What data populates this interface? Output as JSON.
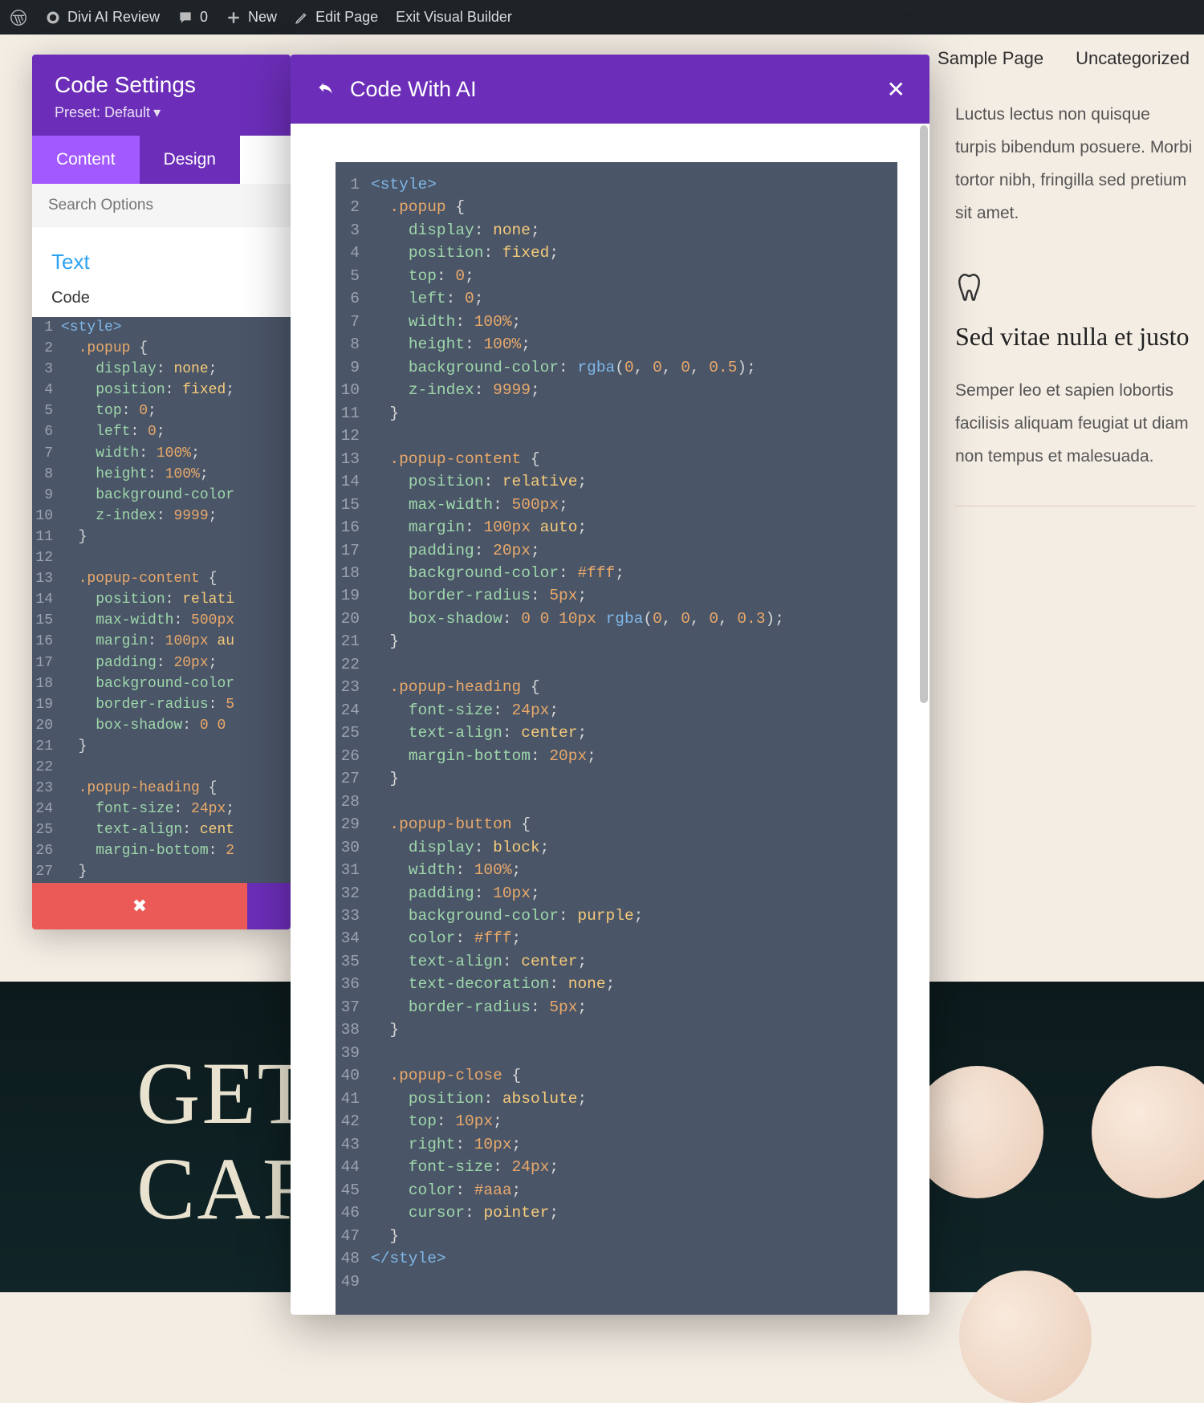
{
  "adminbar": {
    "site_title": "Divi AI Review",
    "comments_count": "0",
    "new_label": "New",
    "edit_page": "Edit Page",
    "exit_vb": "Exit Visual Builder"
  },
  "topnav": {
    "sample": "Sample Page",
    "uncat": "Uncategorized"
  },
  "side": {
    "blurb1_text": "Luctus lectus non quisque turpis bibendum posuere. Morbi tortor nibh, fringilla sed pretium sit amet.",
    "blurb2_title": "Sed vitae nulla et justo",
    "blurb2_text": "Semper leo et sapien lobortis facilisis aliquam feugiat ut diam non tempus et malesuada."
  },
  "hero": {
    "text": "GET\nCAR"
  },
  "sidebar": {
    "title": "Code Settings",
    "preset": "Preset: Default",
    "tabs": {
      "content": "Content",
      "design": "Design"
    },
    "search_placeholder": "Search Options",
    "section_text": "Text",
    "label_code": "Code",
    "code_lines": [
      [
        [
          "tag",
          "<style>"
        ]
      ],
      [
        [
          "p",
          "  "
        ],
        [
          "sel",
          ".popup"
        ],
        [
          "p",
          " {"
        ]
      ],
      [
        [
          "p",
          "    "
        ],
        [
          "prop",
          "display"
        ],
        [
          "p",
          ": "
        ],
        [
          "val",
          "none"
        ],
        [
          "p",
          ";"
        ]
      ],
      [
        [
          "p",
          "    "
        ],
        [
          "prop",
          "position"
        ],
        [
          "p",
          ": "
        ],
        [
          "val",
          "fixed"
        ],
        [
          "p",
          ";"
        ]
      ],
      [
        [
          "p",
          "    "
        ],
        [
          "prop",
          "top"
        ],
        [
          "p",
          ": "
        ],
        [
          "num",
          "0"
        ],
        [
          "p",
          ";"
        ]
      ],
      [
        [
          "p",
          "    "
        ],
        [
          "prop",
          "left"
        ],
        [
          "p",
          ": "
        ],
        [
          "num",
          "0"
        ],
        [
          "p",
          ";"
        ]
      ],
      [
        [
          "p",
          "    "
        ],
        [
          "prop",
          "width"
        ],
        [
          "p",
          ": "
        ],
        [
          "num",
          "100%"
        ],
        [
          "p",
          ";"
        ]
      ],
      [
        [
          "p",
          "    "
        ],
        [
          "prop",
          "height"
        ],
        [
          "p",
          ": "
        ],
        [
          "num",
          "100%"
        ],
        [
          "p",
          ";"
        ]
      ],
      [
        [
          "p",
          "    "
        ],
        [
          "prop",
          "background-color"
        ]
      ],
      [
        [
          "p",
          "    "
        ],
        [
          "prop",
          "z-index"
        ],
        [
          "p",
          ": "
        ],
        [
          "num",
          "9999"
        ],
        [
          "p",
          ";"
        ]
      ],
      [
        [
          "p",
          "  }"
        ]
      ],
      [
        [
          "p",
          ""
        ]
      ],
      [
        [
          "p",
          "  "
        ],
        [
          "sel",
          ".popup-content"
        ],
        [
          "p",
          " {"
        ]
      ],
      [
        [
          "p",
          "    "
        ],
        [
          "prop",
          "position"
        ],
        [
          "p",
          ": "
        ],
        [
          "val",
          "relati"
        ]
      ],
      [
        [
          "p",
          "    "
        ],
        [
          "prop",
          "max-width"
        ],
        [
          "p",
          ": "
        ],
        [
          "num",
          "500px"
        ]
      ],
      [
        [
          "p",
          "    "
        ],
        [
          "prop",
          "margin"
        ],
        [
          "p",
          ": "
        ],
        [
          "num",
          "100px"
        ],
        [
          "p",
          " "
        ],
        [
          "val",
          "au"
        ]
      ],
      [
        [
          "p",
          "    "
        ],
        [
          "prop",
          "padding"
        ],
        [
          "p",
          ": "
        ],
        [
          "num",
          "20px"
        ],
        [
          "p",
          ";"
        ]
      ],
      [
        [
          "p",
          "    "
        ],
        [
          "prop",
          "background-color"
        ]
      ],
      [
        [
          "p",
          "    "
        ],
        [
          "prop",
          "border-radius"
        ],
        [
          "p",
          ": "
        ],
        [
          "num",
          "5"
        ]
      ],
      [
        [
          "p",
          "    "
        ],
        [
          "prop",
          "box-shadow"
        ],
        [
          "p",
          ": "
        ],
        [
          "num",
          "0 0"
        ]
      ],
      [
        [
          "p",
          "  }"
        ]
      ],
      [
        [
          "p",
          ""
        ]
      ],
      [
        [
          "p",
          "  "
        ],
        [
          "sel",
          ".popup-heading"
        ],
        [
          "p",
          " {"
        ]
      ],
      [
        [
          "p",
          "    "
        ],
        [
          "prop",
          "font-size"
        ],
        [
          "p",
          ": "
        ],
        [
          "num",
          "24px"
        ],
        [
          "p",
          ";"
        ]
      ],
      [
        [
          "p",
          "    "
        ],
        [
          "prop",
          "text-align"
        ],
        [
          "p",
          ": "
        ],
        [
          "val",
          "cent"
        ]
      ],
      [
        [
          "p",
          "    "
        ],
        [
          "prop",
          "margin-bottom"
        ],
        [
          "p",
          ": "
        ],
        [
          "num",
          "2"
        ]
      ],
      [
        [
          "p",
          "  }"
        ]
      ]
    ]
  },
  "ai_panel": {
    "title": "Code With AI",
    "code_lines": [
      [
        [
          "tag",
          "<style>"
        ]
      ],
      [
        [
          "p",
          "  "
        ],
        [
          "sel",
          ".popup"
        ],
        [
          "p",
          " {"
        ]
      ],
      [
        [
          "p",
          "    "
        ],
        [
          "prop",
          "display"
        ],
        [
          "p",
          ": "
        ],
        [
          "val",
          "none"
        ],
        [
          "p",
          ";"
        ]
      ],
      [
        [
          "p",
          "    "
        ],
        [
          "prop",
          "position"
        ],
        [
          "p",
          ": "
        ],
        [
          "val",
          "fixed"
        ],
        [
          "p",
          ";"
        ]
      ],
      [
        [
          "p",
          "    "
        ],
        [
          "prop",
          "top"
        ],
        [
          "p",
          ": "
        ],
        [
          "num",
          "0"
        ],
        [
          "p",
          ";"
        ]
      ],
      [
        [
          "p",
          "    "
        ],
        [
          "prop",
          "left"
        ],
        [
          "p",
          ": "
        ],
        [
          "num",
          "0"
        ],
        [
          "p",
          ";"
        ]
      ],
      [
        [
          "p",
          "    "
        ],
        [
          "prop",
          "width"
        ],
        [
          "p",
          ": "
        ],
        [
          "num",
          "100%"
        ],
        [
          "p",
          ";"
        ]
      ],
      [
        [
          "p",
          "    "
        ],
        [
          "prop",
          "height"
        ],
        [
          "p",
          ": "
        ],
        [
          "num",
          "100%"
        ],
        [
          "p",
          ";"
        ]
      ],
      [
        [
          "p",
          "    "
        ],
        [
          "prop",
          "background-color"
        ],
        [
          "p",
          ": "
        ],
        [
          "fn",
          "rgba"
        ],
        [
          "p",
          "("
        ],
        [
          "num",
          "0"
        ],
        [
          "p",
          ", "
        ],
        [
          "num",
          "0"
        ],
        [
          "p",
          ", "
        ],
        [
          "num",
          "0"
        ],
        [
          "p",
          ", "
        ],
        [
          "num",
          "0.5"
        ],
        [
          "p",
          ");"
        ]
      ],
      [
        [
          "p",
          "    "
        ],
        [
          "prop",
          "z-index"
        ],
        [
          "p",
          ": "
        ],
        [
          "num",
          "9999"
        ],
        [
          "p",
          ";"
        ]
      ],
      [
        [
          "p",
          "  }"
        ]
      ],
      [
        [
          "p",
          ""
        ]
      ],
      [
        [
          "p",
          "  "
        ],
        [
          "sel",
          ".popup-content"
        ],
        [
          "p",
          " {"
        ]
      ],
      [
        [
          "p",
          "    "
        ],
        [
          "prop",
          "position"
        ],
        [
          "p",
          ": "
        ],
        [
          "val",
          "relative"
        ],
        [
          "p",
          ";"
        ]
      ],
      [
        [
          "p",
          "    "
        ],
        [
          "prop",
          "max-width"
        ],
        [
          "p",
          ": "
        ],
        [
          "num",
          "500px"
        ],
        [
          "p",
          ";"
        ]
      ],
      [
        [
          "p",
          "    "
        ],
        [
          "prop",
          "margin"
        ],
        [
          "p",
          ": "
        ],
        [
          "num",
          "100px"
        ],
        [
          "p",
          " "
        ],
        [
          "val",
          "auto"
        ],
        [
          "p",
          ";"
        ]
      ],
      [
        [
          "p",
          "    "
        ],
        [
          "prop",
          "padding"
        ],
        [
          "p",
          ": "
        ],
        [
          "num",
          "20px"
        ],
        [
          "p",
          ";"
        ]
      ],
      [
        [
          "p",
          "    "
        ],
        [
          "prop",
          "background-color"
        ],
        [
          "p",
          ": "
        ],
        [
          "num",
          "#fff"
        ],
        [
          "p",
          ";"
        ]
      ],
      [
        [
          "p",
          "    "
        ],
        [
          "prop",
          "border-radius"
        ],
        [
          "p",
          ": "
        ],
        [
          "num",
          "5px"
        ],
        [
          "p",
          ";"
        ]
      ],
      [
        [
          "p",
          "    "
        ],
        [
          "prop",
          "box-shadow"
        ],
        [
          "p",
          ": "
        ],
        [
          "num",
          "0 0 10px"
        ],
        [
          "p",
          " "
        ],
        [
          "fn",
          "rgba"
        ],
        [
          "p",
          "("
        ],
        [
          "num",
          "0"
        ],
        [
          "p",
          ", "
        ],
        [
          "num",
          "0"
        ],
        [
          "p",
          ", "
        ],
        [
          "num",
          "0"
        ],
        [
          "p",
          ", "
        ],
        [
          "num",
          "0.3"
        ],
        [
          "p",
          ");"
        ]
      ],
      [
        [
          "p",
          "  }"
        ]
      ],
      [
        [
          "p",
          ""
        ]
      ],
      [
        [
          "p",
          "  "
        ],
        [
          "sel",
          ".popup-heading"
        ],
        [
          "p",
          " {"
        ]
      ],
      [
        [
          "p",
          "    "
        ],
        [
          "prop",
          "font-size"
        ],
        [
          "p",
          ": "
        ],
        [
          "num",
          "24px"
        ],
        [
          "p",
          ";"
        ]
      ],
      [
        [
          "p",
          "    "
        ],
        [
          "prop",
          "text-align"
        ],
        [
          "p",
          ": "
        ],
        [
          "val",
          "center"
        ],
        [
          "p",
          ";"
        ]
      ],
      [
        [
          "p",
          "    "
        ],
        [
          "prop",
          "margin-bottom"
        ],
        [
          "p",
          ": "
        ],
        [
          "num",
          "20px"
        ],
        [
          "p",
          ";"
        ]
      ],
      [
        [
          "p",
          "  }"
        ]
      ],
      [
        [
          "p",
          ""
        ]
      ],
      [
        [
          "p",
          "  "
        ],
        [
          "sel",
          ".popup-button"
        ],
        [
          "p",
          " {"
        ]
      ],
      [
        [
          "p",
          "    "
        ],
        [
          "prop",
          "display"
        ],
        [
          "p",
          ": "
        ],
        [
          "val",
          "block"
        ],
        [
          "p",
          ";"
        ]
      ],
      [
        [
          "p",
          "    "
        ],
        [
          "prop",
          "width"
        ],
        [
          "p",
          ": "
        ],
        [
          "num",
          "100%"
        ],
        [
          "p",
          ";"
        ]
      ],
      [
        [
          "p",
          "    "
        ],
        [
          "prop",
          "padding"
        ],
        [
          "p",
          ": "
        ],
        [
          "num",
          "10px"
        ],
        [
          "p",
          ";"
        ]
      ],
      [
        [
          "p",
          "    "
        ],
        [
          "prop",
          "background-color"
        ],
        [
          "p",
          ": "
        ],
        [
          "val",
          "purple"
        ],
        [
          "p",
          ";"
        ]
      ],
      [
        [
          "p",
          "    "
        ],
        [
          "prop",
          "color"
        ],
        [
          "p",
          ": "
        ],
        [
          "num",
          "#fff"
        ],
        [
          "p",
          ";"
        ]
      ],
      [
        [
          "p",
          "    "
        ],
        [
          "prop",
          "text-align"
        ],
        [
          "p",
          ": "
        ],
        [
          "val",
          "center"
        ],
        [
          "p",
          ";"
        ]
      ],
      [
        [
          "p",
          "    "
        ],
        [
          "prop",
          "text-decoration"
        ],
        [
          "p",
          ": "
        ],
        [
          "val",
          "none"
        ],
        [
          "p",
          ";"
        ]
      ],
      [
        [
          "p",
          "    "
        ],
        [
          "prop",
          "border-radius"
        ],
        [
          "p",
          ": "
        ],
        [
          "num",
          "5px"
        ],
        [
          "p",
          ";"
        ]
      ],
      [
        [
          "p",
          "  }"
        ]
      ],
      [
        [
          "p",
          ""
        ]
      ],
      [
        [
          "p",
          "  "
        ],
        [
          "sel",
          ".popup-close"
        ],
        [
          "p",
          " {"
        ]
      ],
      [
        [
          "p",
          "    "
        ],
        [
          "prop",
          "position"
        ],
        [
          "p",
          ": "
        ],
        [
          "val",
          "absolute"
        ],
        [
          "p",
          ";"
        ]
      ],
      [
        [
          "p",
          "    "
        ],
        [
          "prop",
          "top"
        ],
        [
          "p",
          ": "
        ],
        [
          "num",
          "10px"
        ],
        [
          "p",
          ";"
        ]
      ],
      [
        [
          "p",
          "    "
        ],
        [
          "prop",
          "right"
        ],
        [
          "p",
          ": "
        ],
        [
          "num",
          "10px"
        ],
        [
          "p",
          ";"
        ]
      ],
      [
        [
          "p",
          "    "
        ],
        [
          "prop",
          "font-size"
        ],
        [
          "p",
          ": "
        ],
        [
          "num",
          "24px"
        ],
        [
          "p",
          ";"
        ]
      ],
      [
        [
          "p",
          "    "
        ],
        [
          "prop",
          "color"
        ],
        [
          "p",
          ": "
        ],
        [
          "num",
          "#aaa"
        ],
        [
          "p",
          ";"
        ]
      ],
      [
        [
          "p",
          "    "
        ],
        [
          "prop",
          "cursor"
        ],
        [
          "p",
          ": "
        ],
        [
          "val",
          "pointer"
        ],
        [
          "p",
          ";"
        ]
      ],
      [
        [
          "p",
          "  }"
        ]
      ],
      [
        [
          "tag",
          "</style>"
        ]
      ],
      [
        [
          "p",
          ""
        ]
      ]
    ]
  }
}
